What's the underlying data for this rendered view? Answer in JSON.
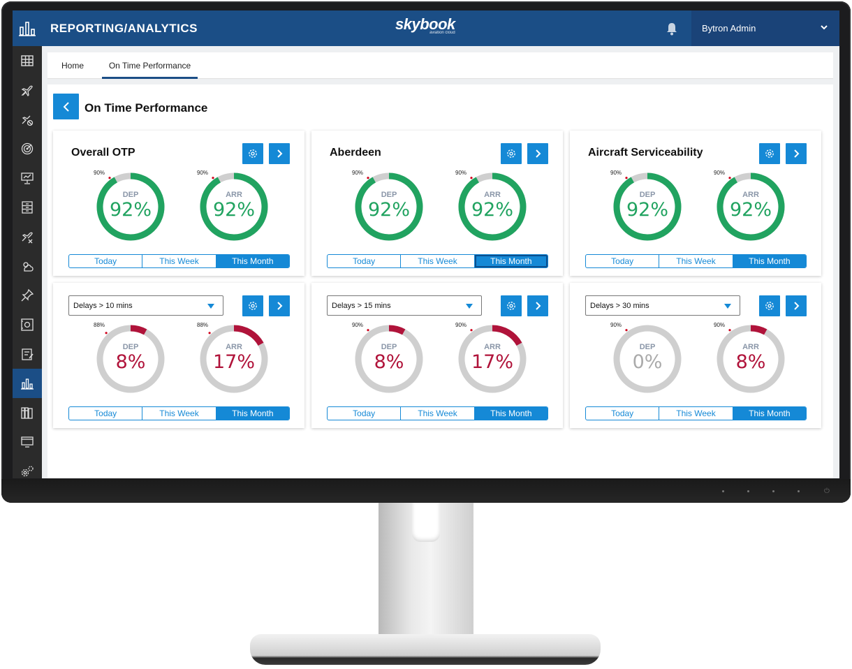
{
  "app": {
    "section_title": "REPORTING/ANALYTICS",
    "brand": "skybook",
    "brand_tagline": "aviation cloud",
    "user_name": "Bytron Admin"
  },
  "tabs": [
    {
      "label": "Home",
      "active": false
    },
    {
      "label": "On Time Performance",
      "active": true
    }
  ],
  "page": {
    "title": "On Time Performance"
  },
  "sidebar": {
    "items": [
      {
        "icon": "grid-icon"
      },
      {
        "icon": "plane-icon"
      },
      {
        "icon": "plane-off-icon"
      },
      {
        "icon": "radar-icon"
      },
      {
        "icon": "presentation-icon"
      },
      {
        "icon": "cabinet-icon"
      },
      {
        "icon": "plane-cross-icon"
      },
      {
        "icon": "weather-icon"
      },
      {
        "icon": "pin-icon"
      },
      {
        "icon": "safe-icon"
      },
      {
        "icon": "checklist-icon"
      },
      {
        "icon": "bar-chart-icon",
        "active": true
      },
      {
        "icon": "books-icon"
      },
      {
        "icon": "monitor-icon"
      },
      {
        "icon": "settings-icon"
      }
    ]
  },
  "segment_labels": [
    "Today",
    "This Week",
    "This Month"
  ],
  "colors": {
    "good": "#21a360",
    "bad": "#b0133a",
    "neutral": "#cfcfcf",
    "muted_text": "#aaaaaa",
    "accent": "#1589d6",
    "header": "#1b4e86"
  },
  "cards": [
    {
      "title": "Overall OTP",
      "gauges": [
        {
          "label": "DEP",
          "value": "92%",
          "fraction": 0.92,
          "threshold": "90%",
          "threshold_fraction": 0.9,
          "status": "good"
        },
        {
          "label": "ARR",
          "value": "92%",
          "fraction": 0.92,
          "threshold": "90%",
          "threshold_fraction": 0.9,
          "status": "good"
        }
      ],
      "selected": 2
    },
    {
      "title": "Aberdeen",
      "gauges": [
        {
          "label": "DEP",
          "value": "92%",
          "fraction": 0.92,
          "threshold": "90%",
          "threshold_fraction": 0.9,
          "status": "good"
        },
        {
          "label": "ARR",
          "value": "92%",
          "fraction": 0.92,
          "threshold": "90%",
          "threshold_fraction": 0.9,
          "status": "good"
        }
      ],
      "selected": 2,
      "focused": true
    },
    {
      "title": "Aircraft Serviceability",
      "gauges": [
        {
          "label": "DEP",
          "value": "92%",
          "fraction": 0.92,
          "threshold": "90%",
          "threshold_fraction": 0.9,
          "status": "good"
        },
        {
          "label": "ARR",
          "value": "92%",
          "fraction": 0.92,
          "threshold": "90%",
          "threshold_fraction": 0.9,
          "status": "good"
        }
      ],
      "selected": 2
    },
    {
      "filter": "Delays > 10 mins",
      "gauges": [
        {
          "label": "DEP",
          "value": "8%",
          "fraction": 0.08,
          "threshold": "88%",
          "threshold_fraction": 0.88,
          "status": "bad"
        },
        {
          "label": "ARR",
          "value": "17%",
          "fraction": 0.17,
          "threshold": "88%",
          "threshold_fraction": 0.88,
          "status": "bad"
        }
      ],
      "selected": 2
    },
    {
      "filter": "Delays > 15 mins",
      "gauges": [
        {
          "label": "DEP",
          "value": "8%",
          "fraction": 0.08,
          "threshold": "90%",
          "threshold_fraction": 0.9,
          "status": "bad"
        },
        {
          "label": "ARR",
          "value": "17%",
          "fraction": 0.17,
          "threshold": "90%",
          "threshold_fraction": 0.9,
          "status": "bad"
        }
      ],
      "selected": 2
    },
    {
      "filter": "Delays > 30 mins",
      "gauges": [
        {
          "label": "DEP",
          "value": "0%",
          "fraction": 0.0,
          "threshold": "90%",
          "threshold_fraction": 0.9,
          "status": "neutral"
        },
        {
          "label": "ARR",
          "value": "8%",
          "fraction": 0.08,
          "threshold": "90%",
          "threshold_fraction": 0.9,
          "status": "bad"
        }
      ],
      "selected": 2
    }
  ]
}
